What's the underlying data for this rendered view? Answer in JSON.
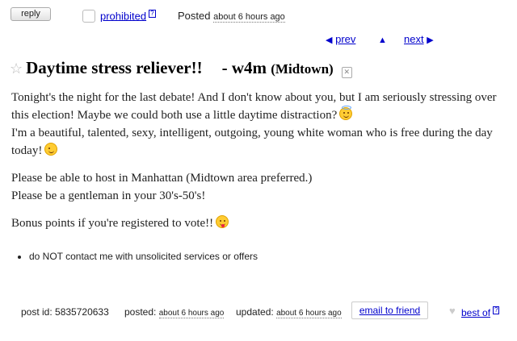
{
  "topbar": {
    "reply_label": "reply",
    "prohibited_label": "prohibited",
    "help_mark": "?",
    "posted_label": "Posted",
    "posted_time": "about 6 hours ago"
  },
  "nav": {
    "prev_arrow": "◀",
    "prev_label": "prev",
    "up_arrow": "▲",
    "next_label": "next",
    "next_arrow": "▶"
  },
  "post": {
    "star": "☆",
    "title": "Daytime stress reliever!!",
    "category": "- w4m",
    "location": "(Midtown)",
    "hide_glyph": "✕",
    "body": {
      "p1": "Tonight's the night for the last debate! And I don't know about you, but I am seriously stressing over this election! Maybe we could both use a little daytime distraction?",
      "p2": "I'm a beautiful, talented, sexy, intelligent, outgoing, young white woman who is free during the day today!",
      "p3a": "Please be able to host in Manhattan (Midtown area preferred.)",
      "p3b": "Please be a gentleman in your 30's-50's!",
      "p4": "Bonus points if you're registered to vote!!"
    },
    "emojis": [
      "angel-emoji",
      "wink-emoji",
      "crazy-face-emoji"
    ]
  },
  "notices": [
    "do NOT contact me with unsolicited services or offers"
  ],
  "footer": {
    "post_id_label": "post id: 5835720633",
    "posted_label": "posted:",
    "posted_time": "about 6 hours ago",
    "updated_label": "updated:",
    "updated_time": "about 6 hours ago",
    "email_label": "email to friend",
    "heart_glyph": "♥",
    "best_of_label": "best of",
    "help_mark": "?"
  },
  "colors": {
    "link": "#0000cc",
    "emoji": "#ffcc33"
  }
}
